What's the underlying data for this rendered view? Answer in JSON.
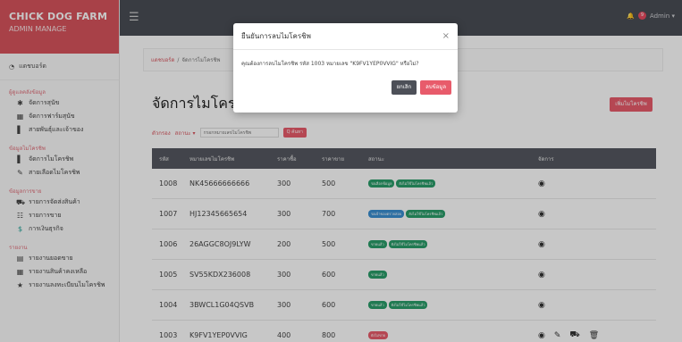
{
  "brand": {
    "line1": "CHICK DOG FARM",
    "line2": "ADMIN MANAGE"
  },
  "topbar": {
    "user": "Admin ▾",
    "badge": "9"
  },
  "sidebar": {
    "dashboard": "แดชบอร์ด",
    "sections": [
      {
        "title": "ผู้ดูแลคลังข้อมูล",
        "items": [
          {
            "label": "จัดการสุนัข",
            "icon": "paw-icon",
            "glyph": "✱",
            "teal": false
          },
          {
            "label": "จัดการฟาร์มสุนัข",
            "icon": "building-icon",
            "glyph": "▦",
            "teal": false
          },
          {
            "label": "สายพันธุ์และเจ้าของ",
            "icon": "bookmark-icon",
            "glyph": "▌",
            "teal": false
          }
        ]
      },
      {
        "title": "ข้อมูลไมโครชิพ",
        "items": [
          {
            "label": "จัดการไมโครชิพ",
            "icon": "chip-icon",
            "glyph": "▌",
            "teal": false
          },
          {
            "label": "สายเลือดไมโครชิพ",
            "icon": "pencil-icon",
            "glyph": "✎",
            "teal": false
          }
        ]
      },
      {
        "title": "ข้อมูลการขาย",
        "items": [
          {
            "label": "รายการจัดส่งสินค้า",
            "icon": "truck-icon",
            "glyph": "⛟",
            "teal": false
          },
          {
            "label": "รายการขาย",
            "icon": "list-icon",
            "glyph": "☷",
            "teal": false
          },
          {
            "label": "การเงินธุรกิจ",
            "icon": "dollar-icon",
            "glyph": "$",
            "teal": true
          }
        ]
      },
      {
        "title": "รายงาน",
        "items": [
          {
            "label": "รายงานยอดขาย",
            "icon": "file-icon",
            "glyph": "▤",
            "teal": false
          },
          {
            "label": "รายงานสินค้าคงเหลือ",
            "icon": "table-icon",
            "glyph": "▦",
            "teal": false
          },
          {
            "label": "รายงานลงทะเบียนไมโครชิพ",
            "icon": "star-icon",
            "glyph": "★",
            "teal": false
          }
        ]
      }
    ]
  },
  "breadcrumb": {
    "home": "แดชบอร์ด",
    "sep": "/",
    "current": "จัดการไมโครชิพ"
  },
  "page": {
    "title": "จัดการไมโครชิพ",
    "add_button": "เพิ่มไมโครชิพ"
  },
  "filters": {
    "label": "ตัวกรอง",
    "select": "สถานะ ▾",
    "search_placeholder": "กรอกหมายเลขไมโครชิพ",
    "search_button": "Q ค้นหา"
  },
  "table": {
    "headers": [
      "รหัส",
      "หมายเลขไมโครชิพ",
      "ราคาซื้อ",
      "ราคาขาย",
      "สถานะ",
      "จัดการ"
    ],
    "rows": [
      {
        "id": "1008",
        "chip": "NK45666666666",
        "buy": "300",
        "sell": "500",
        "badges": [
          {
            "text": "รอเลือกข้อมูล",
            "color": "#2a9d6a"
          },
          {
            "text": "ยังไม่ใช้ไมโครชิพแล้ว",
            "color": "#2a9d6a"
          }
        ],
        "actions": [
          {
            "icon": "eye-icon",
            "glyph": "◉"
          }
        ]
      },
      {
        "id": "1007",
        "chip": "HJ12345665654",
        "buy": "300",
        "sell": "700",
        "badges": [
          {
            "text": "รอเจ้าของตรวจสอบ",
            "color": "#3a8fd1"
          },
          {
            "text": "ยังไม่ใช้ไมโครชิพแล้ว",
            "color": "#2a9d6a"
          }
        ],
        "actions": [
          {
            "icon": "eye-icon",
            "glyph": "◉"
          }
        ]
      },
      {
        "id": "1006",
        "chip": "26AGGC8OJ9LYW",
        "buy": "200",
        "sell": "500",
        "badges": [
          {
            "text": "ขายแล้ว",
            "color": "#2a9d6a"
          },
          {
            "text": "ยังไม่ใช้ไมโครชิพแล้ว",
            "color": "#2a9d6a"
          }
        ],
        "actions": [
          {
            "icon": "eye-icon",
            "glyph": "◉"
          }
        ]
      },
      {
        "id": "1005",
        "chip": "SV55KDX236008",
        "buy": "300",
        "sell": "600",
        "badges": [
          {
            "text": "ขายแล้ว",
            "color": "#2a9d6a"
          }
        ],
        "actions": [
          {
            "icon": "eye-icon",
            "glyph": "◉"
          }
        ]
      },
      {
        "id": "1004",
        "chip": "3BWCL1G04QSVB",
        "buy": "300",
        "sell": "600",
        "badges": [
          {
            "text": "ขายแล้ว",
            "color": "#2a9d6a"
          },
          {
            "text": "ยังไม่ใช้ไมโครชิพแล้ว",
            "color": "#2a9d6a"
          }
        ],
        "actions": [
          {
            "icon": "eye-icon",
            "glyph": "◉"
          }
        ]
      },
      {
        "id": "1003",
        "chip": "K9FV1YEP0VVIG",
        "buy": "400",
        "sell": "800",
        "badges": [
          {
            "text": "ยังไม่ขาย",
            "color": "#e85b6b"
          }
        ],
        "actions": [
          {
            "icon": "eye-icon",
            "glyph": "◉"
          },
          {
            "icon": "edit-icon",
            "glyph": "✎"
          },
          {
            "icon": "truck-icon",
            "glyph": "⛟"
          },
          {
            "icon": "trash-icon",
            "glyph": "🗑"
          }
        ]
      }
    ]
  },
  "modal": {
    "title": "ยืนยันการลบไมโครชิพ",
    "close": "×",
    "message": "คุณต้องการลบไมโครชิพ รหัส 1003 หมายเลข \"K9FV1YEP0VVIG\" หรือไม่?",
    "cancel": "ยกเลิก",
    "confirm": "ลบข้อมูล"
  },
  "colors": {
    "accent": "#e85b6b",
    "brand": "#d8545d",
    "topbar": "#4a4d55",
    "table_header": "#555860"
  }
}
